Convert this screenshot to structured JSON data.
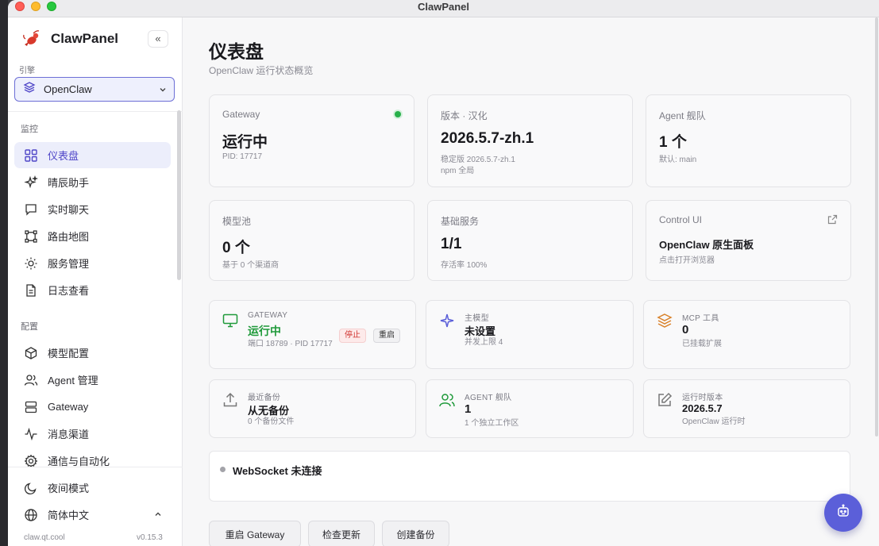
{
  "window": {
    "title": "ClawPanel"
  },
  "sidebar": {
    "brand": "ClawPanel",
    "collapse_glyph": "«",
    "engine_label": "引擎",
    "engine_value": "OpenClaw",
    "sections": {
      "monitor": "监控",
      "config": "配置"
    },
    "monitor_items": [
      {
        "label": "仪表盘",
        "icon": "grid-icon",
        "active": true
      },
      {
        "label": "晴辰助手",
        "icon": "sparkle-icon"
      },
      {
        "label": "实时聊天",
        "icon": "chat-icon"
      },
      {
        "label": "路由地图",
        "icon": "route-icon"
      },
      {
        "label": "服务管理",
        "icon": "sun-gear-icon"
      },
      {
        "label": "日志查看",
        "icon": "document-icon"
      }
    ],
    "config_items": [
      {
        "label": "模型配置",
        "icon": "cube-icon"
      },
      {
        "label": "Agent 管理",
        "icon": "users-icon"
      },
      {
        "label": "Gateway",
        "icon": "server-icon"
      },
      {
        "label": "消息渠道",
        "icon": "activity-icon"
      },
      {
        "label": "通信与自动化",
        "icon": "gear-icon"
      }
    ],
    "night_mode": "夜间模式",
    "language": "简体中文",
    "footer_left": "claw.qt.cool",
    "footer_right": "v0.15.3"
  },
  "main": {
    "title": "仪表盘",
    "subtitle": "OpenClaw 运行状态概览",
    "cards": [
      {
        "label": "Gateway",
        "value": "运行中",
        "sub1": "PID: 17717",
        "sub2": ""
      },
      {
        "label": "版本 · 汉化",
        "value": "2026.5.7-zh.1",
        "sub1": "稳定版 2026.5.7-zh.1",
        "sub2": "npm 全局"
      },
      {
        "label": "Agent 舰队",
        "value": "1 个",
        "sub1": "默认: main",
        "sub2": ""
      },
      {
        "label": "模型池",
        "value": "0 个",
        "sub1": "基于 0 个渠道商",
        "sub2": ""
      },
      {
        "label": "基础服务",
        "value": "1/1",
        "sub1": "存活率 100%",
        "sub2": ""
      },
      {
        "label": "Control UI",
        "value": "OpenClaw 原生面板",
        "sub1": "点击打开浏览器",
        "sub2": ""
      }
    ],
    "status_cards": [
      {
        "l1": "GATEWAY",
        "l2": "运行中",
        "l3": "端口 18789 · PID 17717",
        "icon": "monitor-icon"
      },
      {
        "l1": "主模型",
        "l2": "未设置",
        "l3": "并发上限 4",
        "icon": "sparkle-icon"
      },
      {
        "l1": "MCP 工具",
        "l2": "0",
        "l3": "已挂载扩展",
        "icon": "layers-icon"
      },
      {
        "l1": "最近备份",
        "l2": "从无备份",
        "l3": "0 个备份文件",
        "icon": "upload-icon"
      },
      {
        "l1": "AGENT 舰队",
        "l2": "1",
        "l3": "1 个独立工作区",
        "icon": "users-icon"
      },
      {
        "l1": "运行时版本",
        "l2": "2026.5.7",
        "l3": "OpenClaw 运行时",
        "icon": "edit-icon"
      }
    ],
    "gateway_buttons": {
      "stop": "停止",
      "restart": "重启"
    },
    "websocket": "WebSocket 未连接",
    "actions": [
      "重启 Gateway",
      "检查更新",
      "创建备份"
    ]
  },
  "colors": {
    "accent": "#5b5fd9",
    "running": "#1f9a3a",
    "stop": "#d0312d",
    "mcp": "#d9822b"
  }
}
